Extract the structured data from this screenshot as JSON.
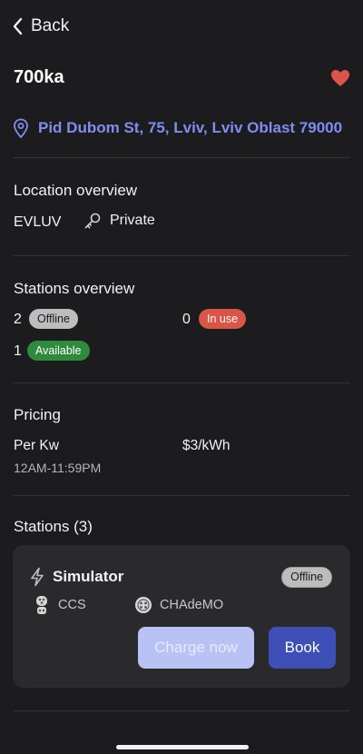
{
  "nav": {
    "back_label": "Back"
  },
  "location": {
    "name": "700ka",
    "address": "Pid Dubom St, 75, Lviv, Lviv Oblast 79000",
    "favorite_color": "#e0534a",
    "accent_color": "#7f8df0"
  },
  "overview": {
    "title": "Location overview",
    "operator": "EVLUV",
    "access": "Private"
  },
  "stations_overview": {
    "title": "Stations overview",
    "offline_count": "2",
    "offline_label": "Offline",
    "in_use_count": "0",
    "in_use_label": "In use",
    "available_count": "1",
    "available_label": "Available"
  },
  "pricing": {
    "title": "Pricing",
    "unit_label": "Per Kw",
    "price": "$3/kWh",
    "hours": "12AM-11:59PM"
  },
  "stations": {
    "title": "Stations (3)",
    "items": [
      {
        "name": "Simulator",
        "status": "Offline",
        "connectors": [
          "CCS",
          "CHAdeMO"
        ],
        "charge_label": "Charge now",
        "book_label": "Book"
      }
    ]
  },
  "icons": {
    "back": "chevron-left-icon",
    "favorite": "heart-icon",
    "address": "location-pin-icon",
    "access": "key-icon",
    "station": "lightning-icon",
    "ccs": "ccs-connector-icon",
    "chademo": "chademo-connector-icon"
  }
}
